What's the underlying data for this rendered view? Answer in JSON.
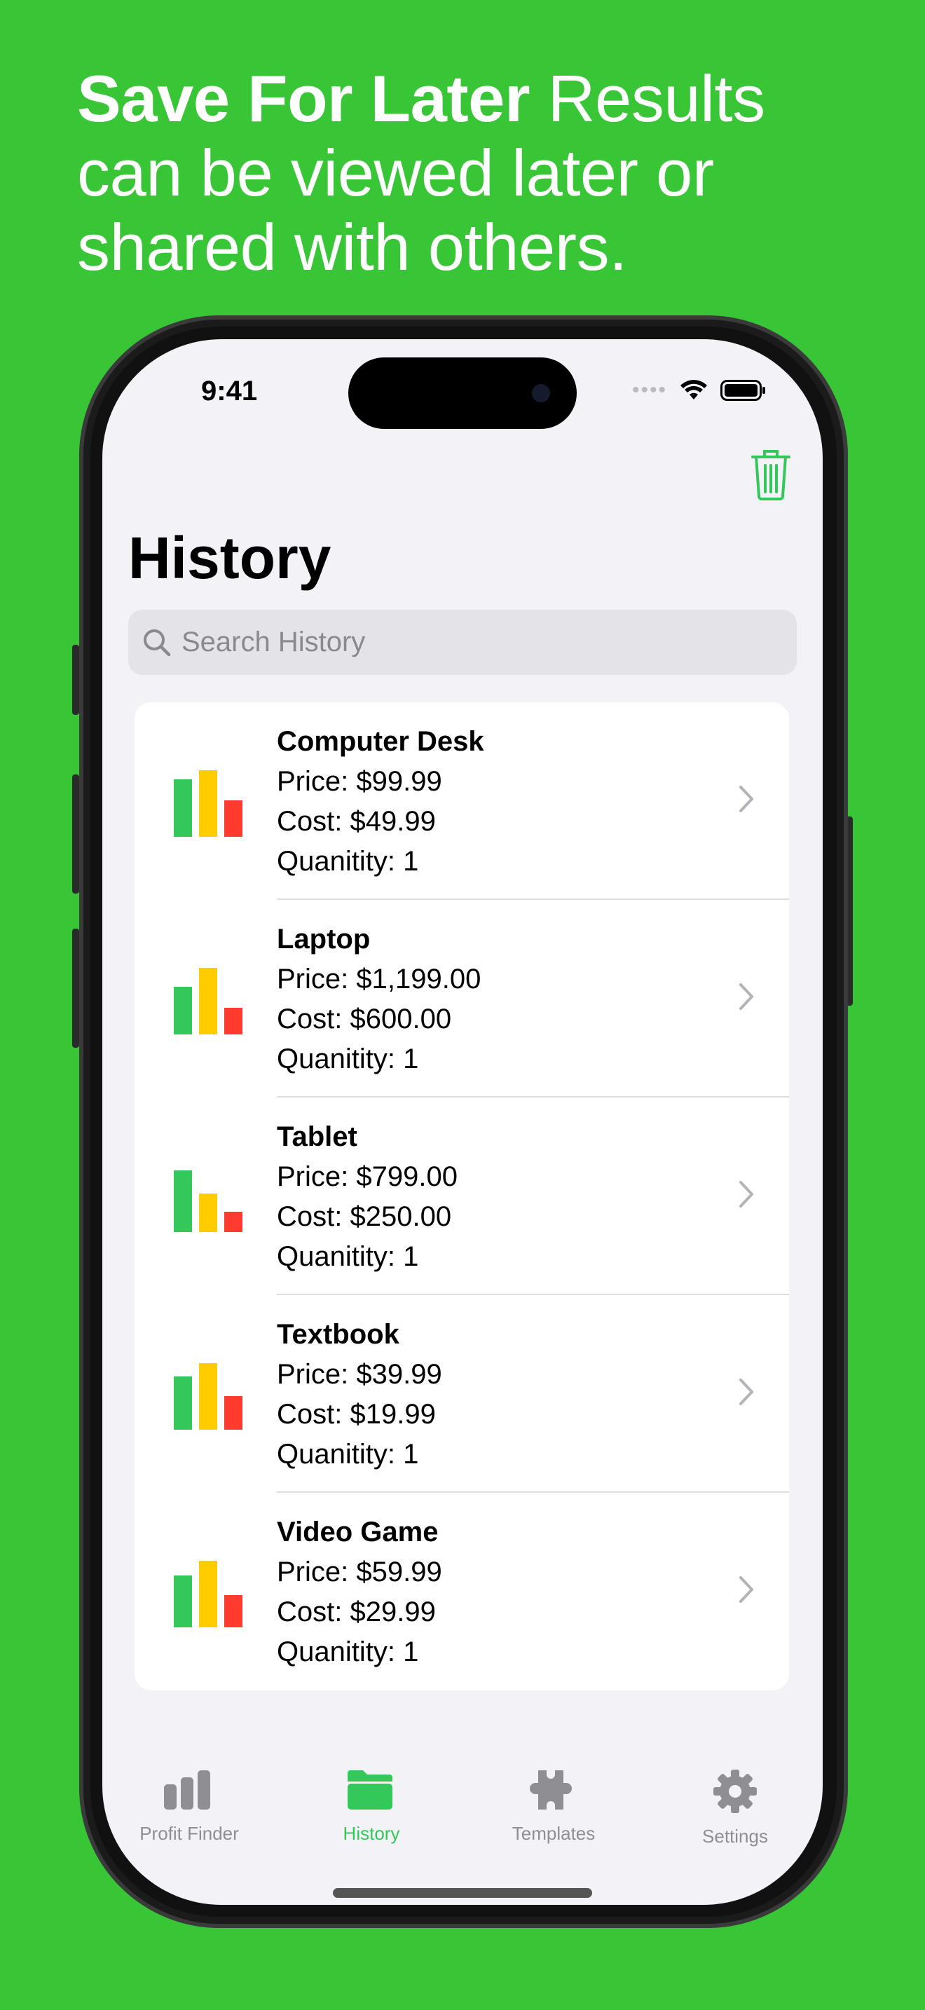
{
  "headline": {
    "bold": "Save For Later",
    "rest": " Results can be viewed later or shared with others."
  },
  "status": {
    "time": "9:41"
  },
  "page": {
    "title": "History",
    "trash_icon": "trash-icon"
  },
  "search": {
    "placeholder": "Search History"
  },
  "colors": {
    "accent": "#34c759",
    "background": "#38c536",
    "bar_green": "#34c759",
    "bar_yellow": "#ffcc00",
    "bar_red": "#ff3b30"
  },
  "items": [
    {
      "name": "Computer Desk",
      "price": "Price: $99.99",
      "cost": "Cost: $49.99",
      "quantity": "Quanitity: 1",
      "bar_levels": [
        0.86,
        1,
        0.55
      ]
    },
    {
      "name": "Laptop",
      "price": "Price: $1,199.00",
      "cost": "Cost: $600.00",
      "quantity": "Quanitity: 1",
      "bar_levels": [
        0.72,
        1,
        0.4
      ]
    },
    {
      "name": "Tablet",
      "price": "Price: $799.00",
      "cost": "Cost: $250.00",
      "quantity": "Quanitity: 1",
      "bar_levels": [
        0.93,
        0.58,
        0.3
      ]
    },
    {
      "name": "Textbook",
      "price": "Price: $39.99",
      "cost": "Cost: $19.99",
      "quantity": "Quanitity: 1",
      "bar_levels": [
        0.8,
        1,
        0.5
      ]
    },
    {
      "name": "Video Game",
      "price": "Price: $59.99",
      "cost": "Cost: $29.99",
      "quantity": "Quanitity: 1",
      "bar_levels": [
        0.78,
        1,
        0.48
      ]
    }
  ],
  "tabs": [
    {
      "label": "Profit Finder",
      "icon": "chart-bar-icon",
      "active": false
    },
    {
      "label": "History",
      "icon": "folder-icon",
      "active": true
    },
    {
      "label": "Templates",
      "icon": "puzzle-icon",
      "active": false
    },
    {
      "label": "Settings",
      "icon": "gear-icon",
      "active": false
    }
  ]
}
